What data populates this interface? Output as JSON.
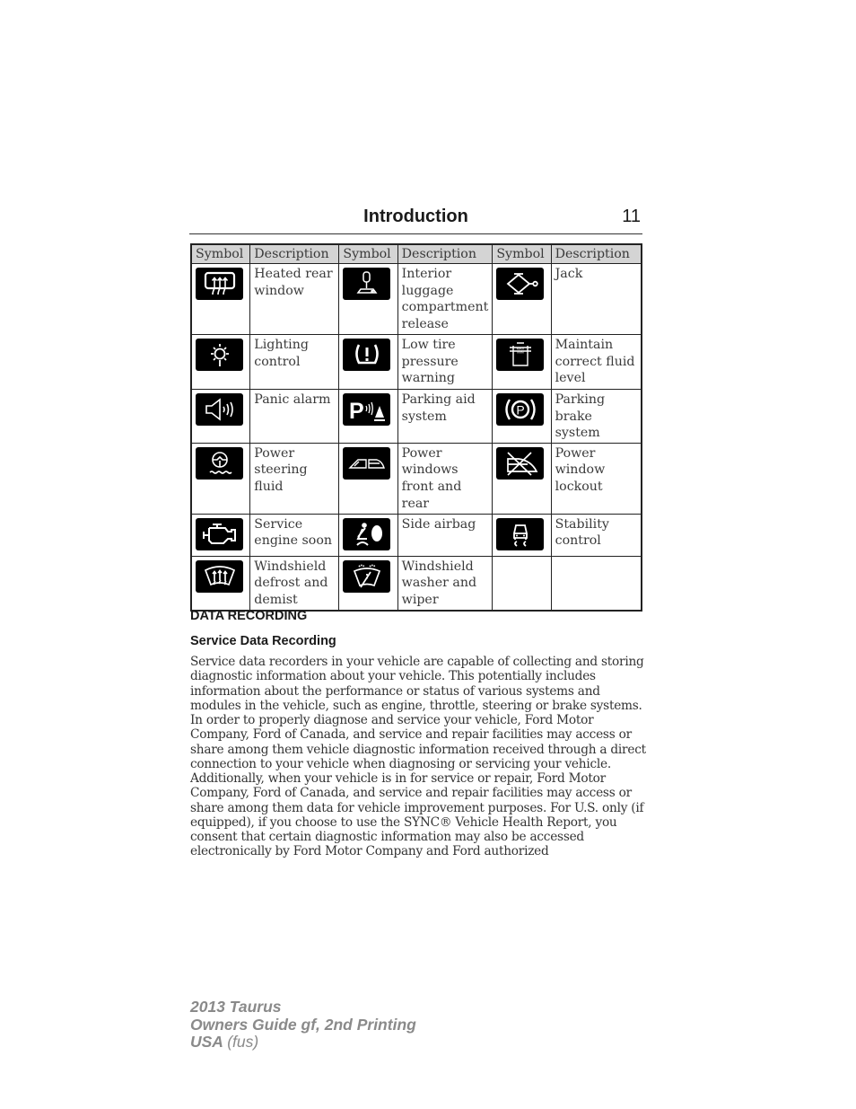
{
  "header": {
    "title": "Introduction",
    "page_number": "11"
  },
  "table": {
    "headers": [
      "Symbol",
      "Description",
      "Symbol",
      "Description",
      "Symbol",
      "Description"
    ],
    "rows": [
      [
        {
          "icon": "heated-rear-window-icon",
          "description": "Heated rear window"
        },
        {
          "icon": "interior-luggage-release-icon",
          "description": "Interior luggage compartment release"
        },
        {
          "icon": "jack-icon",
          "description": "Jack"
        }
      ],
      [
        {
          "icon": "lighting-control-icon",
          "description": "Lighting control"
        },
        {
          "icon": "low-tire-pressure-icon",
          "description": "Low tire pressure warning"
        },
        {
          "icon": "fluid-level-icon",
          "description": "Maintain correct fluid level"
        }
      ],
      [
        {
          "icon": "panic-alarm-icon",
          "description": "Panic alarm"
        },
        {
          "icon": "parking-aid-icon",
          "description": "Parking aid system"
        },
        {
          "icon": "parking-brake-icon",
          "description": "Parking brake system"
        }
      ],
      [
        {
          "icon": "power-steering-fluid-icon",
          "description": "Power steering fluid"
        },
        {
          "icon": "power-windows-icon",
          "description": "Power windows front and rear"
        },
        {
          "icon": "power-window-lockout-icon",
          "description": "Power window lockout"
        }
      ],
      [
        {
          "icon": "service-engine-icon",
          "description": "Service engine soon"
        },
        {
          "icon": "side-airbag-icon",
          "description": "Side airbag"
        },
        {
          "icon": "stability-control-icon",
          "description": "Stability control"
        }
      ],
      [
        {
          "icon": "windshield-defrost-icon",
          "description": "Windshield defrost and demist"
        },
        {
          "icon": "windshield-washer-icon",
          "description": "Windshield washer and wiper"
        },
        {
          "icon": "",
          "description": ""
        }
      ]
    ],
    "icon_labels": {
      "fluid_max": "MAX",
      "fluid_min": "MIN",
      "parking_p": "P"
    }
  },
  "sections": {
    "data_recording": "DATA RECORDING",
    "service_data_recording": "Service Data Recording",
    "paragraph": "Service data recorders in your vehicle are capable of collecting and storing diagnostic information about your vehicle. This potentially includes information about the performance or status of various systems and modules in the vehicle, such as engine, throttle, steering or brake systems. In order to properly diagnose and service your vehicle, Ford Motor Company, Ford of Canada, and service and repair facilities may access or share among them vehicle diagnostic information received through a direct connection to your vehicle when diagnosing or servicing your vehicle. Additionally, when your vehicle is in for service or repair, Ford Motor Company, Ford of Canada, and service and repair facilities may access or share among them data for vehicle improvement purposes. For U.S. only (if equipped), if you choose to use the SYNC® Vehicle Health Report, you consent that certain diagnostic information may also be accessed electronically by Ford Motor Company and Ford authorized"
  },
  "footer": {
    "line1": "2013 Taurus",
    "line2": "Owners Guide gf, 2nd Printing",
    "line3_main": "USA",
    "line3_code": "(fus)"
  }
}
